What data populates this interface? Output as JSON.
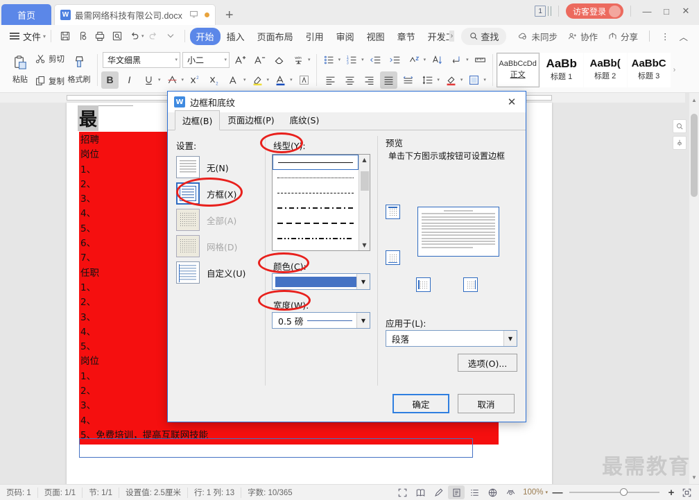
{
  "tabbar": {
    "home_label": "首页",
    "doc_name": "最需网络科技有限公司.docx",
    "add_tab": "+",
    "page_count": "1",
    "login_label": "访客登录",
    "minimize": "—",
    "maximize": "□",
    "close": "✕"
  },
  "menubar": {
    "file_label": "文件",
    "tabs": [
      {
        "label": "开始",
        "active": true
      },
      {
        "label": "插入",
        "active": false
      },
      {
        "label": "页面布局",
        "active": false
      },
      {
        "label": "引用",
        "active": false
      },
      {
        "label": "审阅",
        "active": false
      },
      {
        "label": "视图",
        "active": false
      },
      {
        "label": "章节",
        "active": false
      },
      {
        "label": "开发工具",
        "active": false
      }
    ],
    "scroll_more": "›",
    "find_label": "查找",
    "sync_label": "未同步",
    "collab_label": "协作",
    "share_label": "分享",
    "more": "⋮",
    "collapse": "︿"
  },
  "ribbon": {
    "paste_label": "粘贴",
    "cut_label": "剪切",
    "copy_label": "复制",
    "formatpainter_label": "格式刷",
    "font_name": "华文细黑",
    "font_size": "小二",
    "styles": [
      {
        "preview": "AaBbCcDd",
        "label": "正文",
        "selected": true
      },
      {
        "preview": "AaBb",
        "label": "标题 1",
        "selected": false
      },
      {
        "preview": "AaBb(",
        "label": "标题 2",
        "selected": false
      },
      {
        "preview": "AaBbC",
        "label": "标题 3",
        "selected": false
      }
    ]
  },
  "document": {
    "title": "最",
    "lines": [
      "招聘",
      "岗位",
      "1、",
      "2、",
      "3、",
      "4、",
      "5、",
      "6、",
      "7、",
      "任职",
      "1、",
      "2、",
      "3、",
      "4、",
      "5、",
      "岗位",
      "1、",
      "2、",
      "3、",
      "4、",
      "5、免费培训，提高互联网技能"
    ],
    "watermark": "最需教育"
  },
  "dialog": {
    "title": "边框和底纹",
    "close": "✕",
    "tabs": [
      {
        "label": "边框(B)",
        "active": true
      },
      {
        "label": "页面边框(P)",
        "active": false
      },
      {
        "label": "底纹(S)",
        "active": false
      }
    ],
    "setting_label": "设置:",
    "settings": [
      {
        "label": "无(N)",
        "selected": false,
        "disabled": false
      },
      {
        "label": "方框(X)",
        "selected": true,
        "disabled": false
      },
      {
        "label": "全部(A)",
        "selected": false,
        "disabled": true
      },
      {
        "label": "网格(D)",
        "selected": false,
        "disabled": true
      },
      {
        "label": "自定义(U)",
        "selected": false,
        "disabled": false
      }
    ],
    "linestyle_label": "线型(Y):",
    "color_label": "颜色(C):",
    "color_value": "#4472c4",
    "width_label": "宽度(W):",
    "width_value": "0.5  磅",
    "preview_label": "预览",
    "preview_hint": "单击下方图示或按钮可设置边框",
    "apply_label": "应用于(L):",
    "apply_value": "段落",
    "options_label": "选项(O)...",
    "ok_label": "确定",
    "cancel_label": "取消"
  },
  "statusbar": {
    "items": [
      "页码: 1",
      "页面: 1/1",
      "节: 1/1",
      "设置值: 2.5厘米",
      "行: 1   列: 13",
      "字数: 10/365"
    ],
    "zoom": "100%",
    "zoom_out": "—",
    "zoom_in": "+"
  }
}
